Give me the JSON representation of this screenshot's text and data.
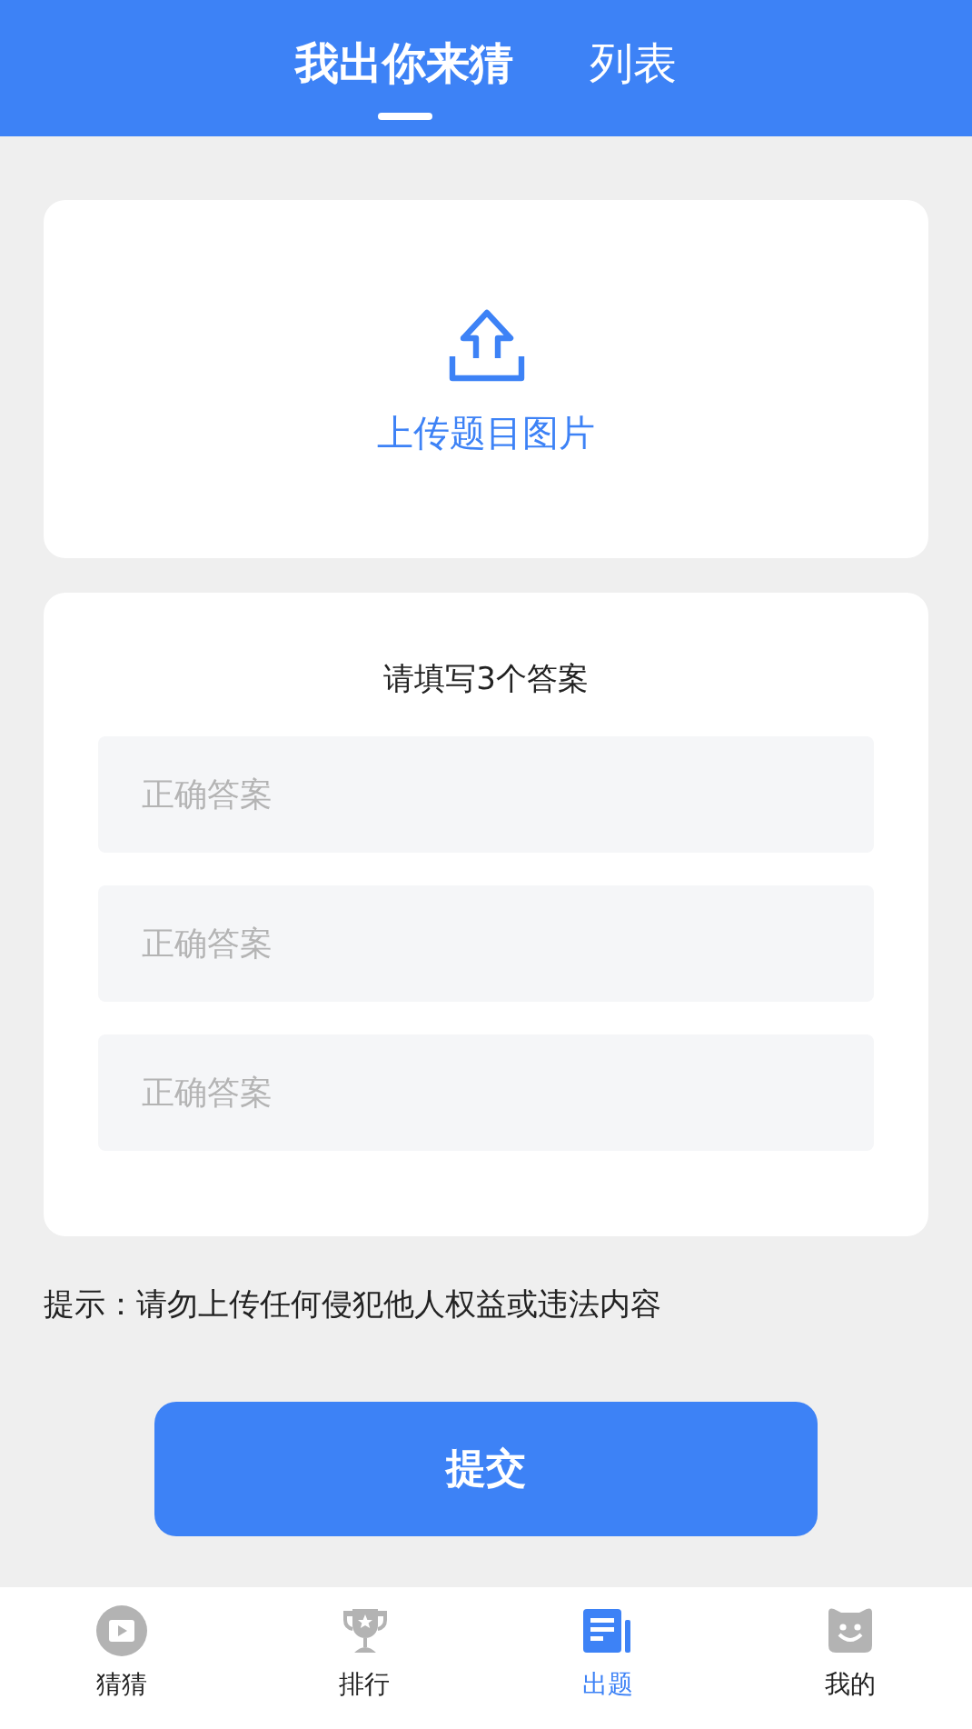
{
  "tabs": [
    {
      "label": "我出你来猜",
      "selected": true
    },
    {
      "label": "列表",
      "selected": false
    }
  ],
  "upload": {
    "label": "上传题目图片"
  },
  "answers": {
    "title": "请填写3个答案",
    "fields": [
      {
        "placeholder": "正确答案"
      },
      {
        "placeholder": "正确答案"
      },
      {
        "placeholder": "正确答案"
      }
    ]
  },
  "tip": "提示：请勿上传任何侵犯他人权益或违法内容",
  "submit": "提交",
  "nav": [
    {
      "label": "猜猜",
      "kind": "play",
      "selected": false
    },
    {
      "label": "排行",
      "kind": "trophy",
      "selected": false
    },
    {
      "label": "出题",
      "kind": "document",
      "selected": true
    },
    {
      "label": "我的",
      "kind": "face",
      "selected": false
    }
  ]
}
